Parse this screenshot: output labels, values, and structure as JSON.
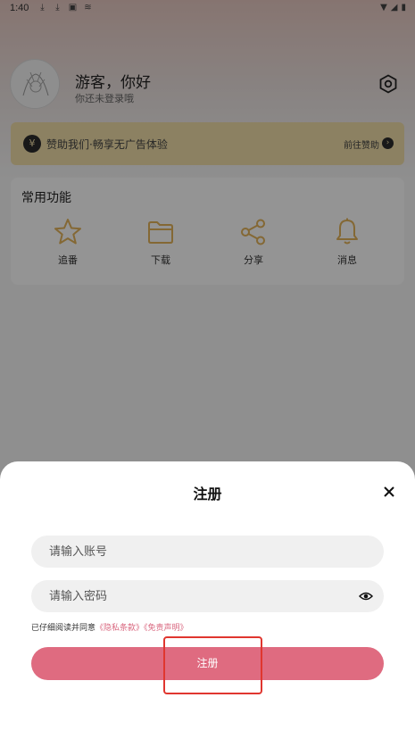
{
  "status_bar": {
    "time": "1:40",
    "left_icons": [
      "download-icon",
      "download-icon",
      "a-badge-icon",
      "cast-icon"
    ],
    "right_icons": [
      "wifi-icon",
      "signal-icon",
      "battery-icon"
    ]
  },
  "profile": {
    "greeting": "游客，你好",
    "subtitle": "你还未登录哦"
  },
  "sponsor": {
    "coin": "¥",
    "text": "赞助我们·畅享无广告体验",
    "link": "前往赞助",
    "arrow": "›"
  },
  "functions": {
    "title": "常用功能",
    "items": [
      {
        "label": "追番",
        "icon": "star-icon"
      },
      {
        "label": "下载",
        "icon": "folder-icon"
      },
      {
        "label": "分享",
        "icon": "share-icon"
      },
      {
        "label": "消息",
        "icon": "bell-icon"
      }
    ]
  },
  "dialog": {
    "title": "注册",
    "close": "close-icon",
    "account_placeholder": "请输入账号",
    "password_placeholder": "请输入密码",
    "agree_prefix": "已仔细阅读并同意",
    "privacy_link": "《隐私条款》",
    "disclaimer_link": "《免责声明》",
    "register_label": "注册"
  },
  "colors": {
    "accent": "#df6b80",
    "icon_gold": "#e3b35b",
    "sponsor_bg": "#f1dfa9",
    "highlight": "#e0362f"
  }
}
